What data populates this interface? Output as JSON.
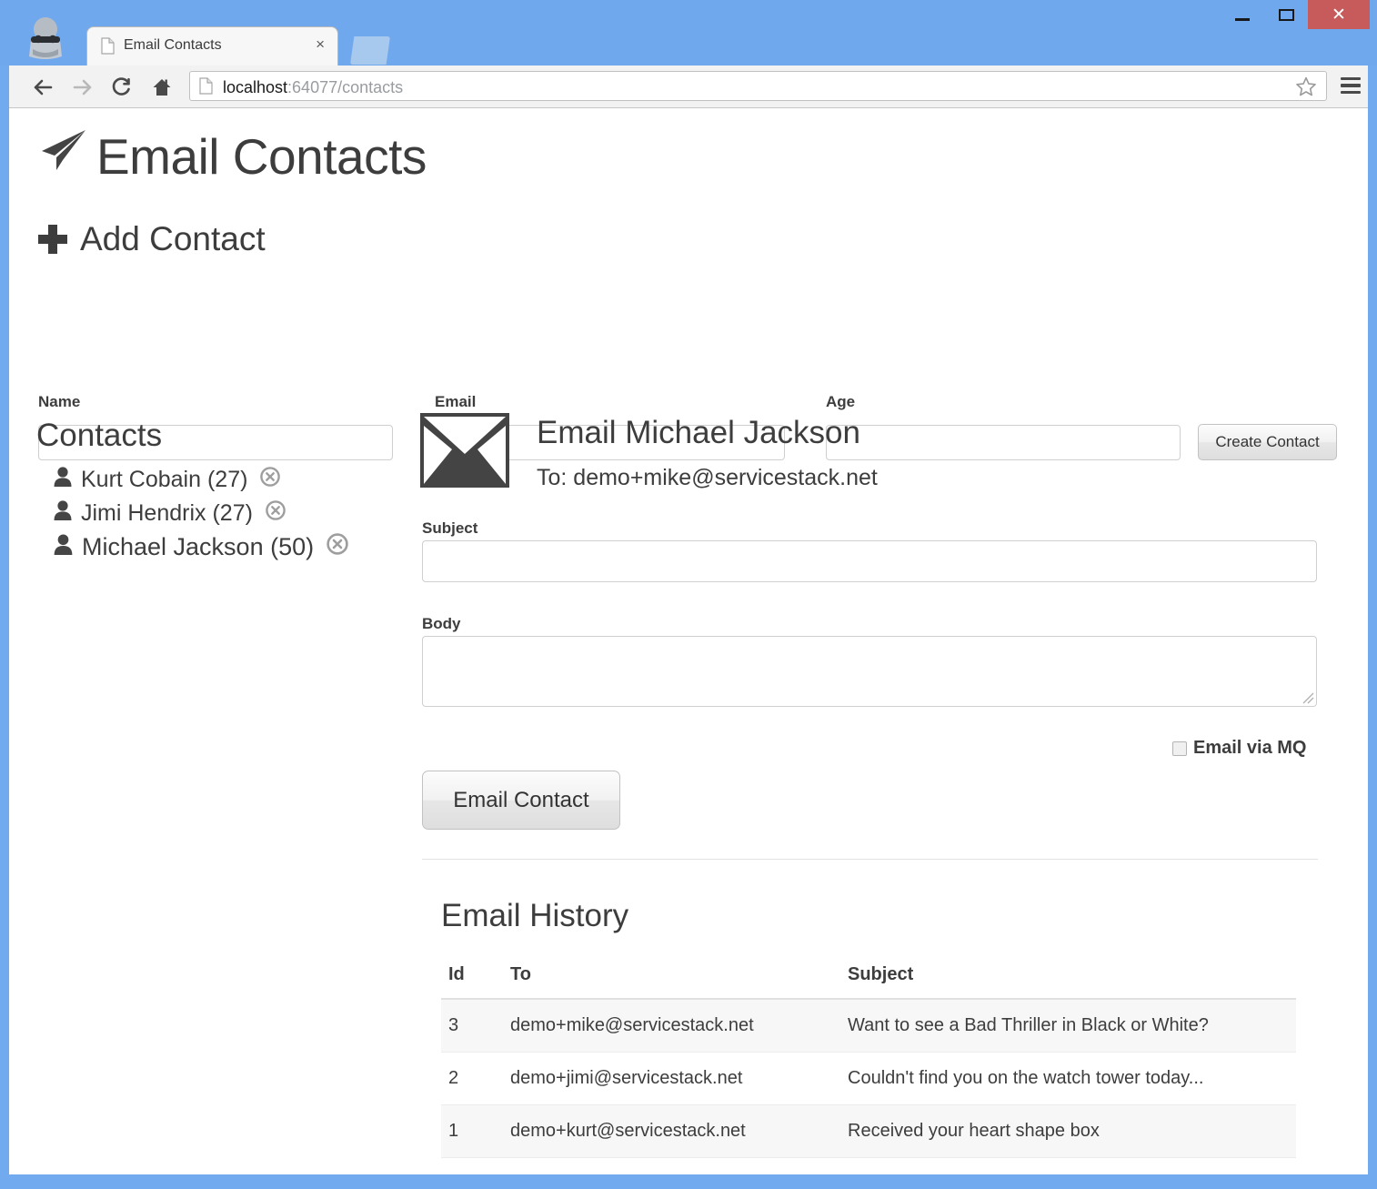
{
  "window": {
    "minimize_label": "–",
    "maximize_label": "",
    "close_label": "✕"
  },
  "browser": {
    "tab": {
      "title": "Email Contacts",
      "close_label": "×"
    },
    "address": {
      "host": "localhost",
      "path": ":64077/contacts"
    }
  },
  "page": {
    "title": "Email Contacts",
    "add_contact": {
      "heading": "Add Contact",
      "fields": {
        "name_label": "Name",
        "name_value": "",
        "email_label": "Email",
        "email_value": "",
        "age_label": "Age",
        "age_value": ""
      },
      "create_button": "Create Contact"
    },
    "contacts": {
      "heading": "Contacts",
      "items": [
        {
          "name": "Kurt Cobain",
          "age": "(27)",
          "label": "Kurt Cobain (27)",
          "selected": false
        },
        {
          "name": "Jimi Hendrix",
          "age": "(27)",
          "label": "Jimi Hendrix (27)",
          "selected": false
        },
        {
          "name": "Michael Jackson",
          "age": "(50)",
          "label": "Michael Jackson (50)",
          "selected": true
        }
      ]
    },
    "email_form": {
      "heading": "Email Michael Jackson",
      "to_line": "To: demo+mike@servicestack.net",
      "subject_label": "Subject",
      "subject_value": "",
      "body_label": "Body",
      "body_value": "",
      "mq_label": "Email via MQ",
      "mq_checked": false,
      "send_button": "Email Contact"
    },
    "email_history": {
      "heading": "Email History",
      "columns": [
        "Id",
        "To",
        "Subject"
      ],
      "rows": [
        {
          "id": "3",
          "to": "demo+mike@servicestack.net",
          "subject": "Want to see a Bad Thriller in Black or White?"
        },
        {
          "id": "2",
          "to": "demo+jimi@servicestack.net",
          "subject": "Couldn't find you on the watch tower today..."
        },
        {
          "id": "1",
          "to": "demo+kurt@servicestack.net",
          "subject": "Received your heart shape box"
        }
      ]
    }
  },
  "colors": {
    "window_frame": "#72aaf0",
    "close_button": "#c75b5b",
    "text": "#3d3d3d",
    "input_border": "#cfcfcf",
    "row_stripe": "#f7f7f7"
  }
}
